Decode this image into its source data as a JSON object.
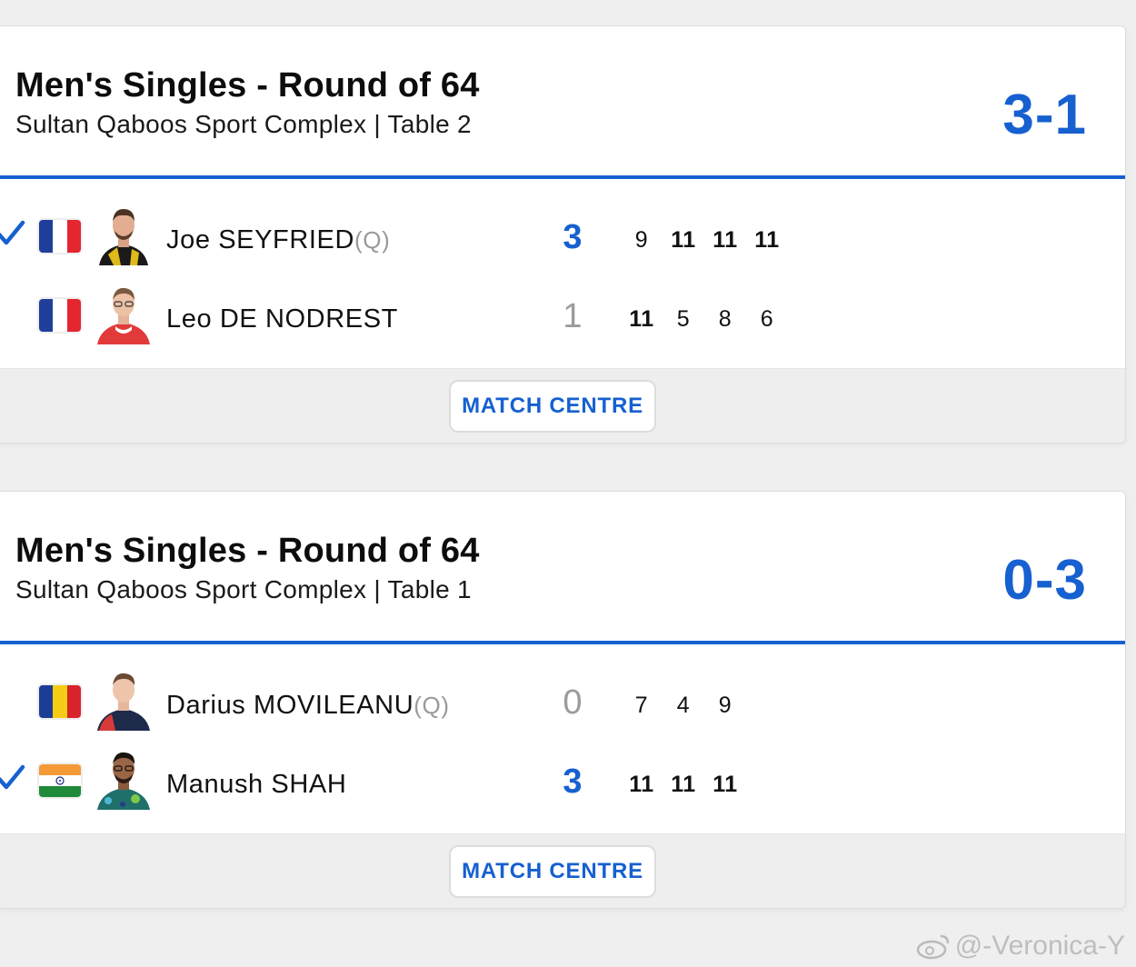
{
  "accent_color": "#1660d0",
  "matches": [
    {
      "title": "Men's Singles - Round of 64",
      "subtitle": "Sultan Qaboos Sport Complex | Table 2",
      "overall_score": "3-1",
      "button_label": "MATCH CENTRE",
      "players": [
        {
          "name": "Joe SEYFRIED",
          "qualifier": "(Q)",
          "country_flag": "france-flag",
          "winner": true,
          "games": "3",
          "sets": [
            "9",
            "11",
            "11",
            "11"
          ]
        },
        {
          "name": "Leo DE NODREST",
          "qualifier": "",
          "country_flag": "france-flag",
          "winner": false,
          "games": "1",
          "sets": [
            "11",
            "5",
            "8",
            "6"
          ]
        }
      ]
    },
    {
      "title": "Men's Singles - Round of 64",
      "subtitle": "Sultan Qaboos Sport Complex | Table 1",
      "overall_score": "0-3",
      "button_label": "MATCH CENTRE",
      "players": [
        {
          "name": "Darius MOVILEANU",
          "qualifier": "(Q)",
          "country_flag": "romania-flag",
          "winner": false,
          "games": "0",
          "sets": [
            "7",
            "4",
            "9"
          ]
        },
        {
          "name": "Manush SHAH",
          "qualifier": "",
          "country_flag": "india-flag",
          "winner": true,
          "games": "3",
          "sets": [
            "11",
            "11",
            "11"
          ]
        }
      ]
    }
  ],
  "watermark": "@-Veronica-Y"
}
